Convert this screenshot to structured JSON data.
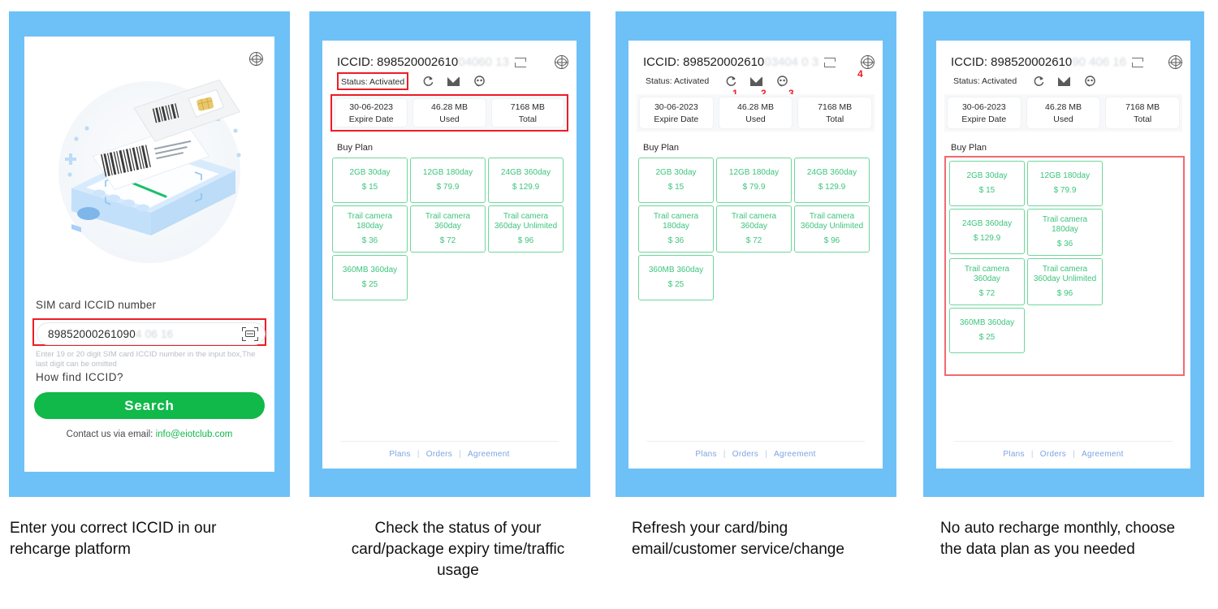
{
  "theme": {
    "blue_frame": "#6ec1f7",
    "red_highlight": "#ee1c25",
    "green_accent": "#10b949",
    "plan_green": "#3ec47d",
    "link_blue": "#7ea4e0"
  },
  "panel1": {
    "globe_icon": "globe-icon",
    "field_label": "SIM card ICCID number",
    "iccid_visible": "89852000261090",
    "iccid_masked": "4 06 16",
    "scan_icon": "barcode-scan-icon",
    "hint": "Enter 19 or 20 digit SIM card ICCID number in the input box,The last digit can be omitted",
    "how_find": "How find ICCID?",
    "search_label": "Search",
    "contact_prefix": "Contact us via email: ",
    "contact_email": "info@eiotclub.com"
  },
  "panel2": {
    "iccid_prefix": "ICCID: 898520002610",
    "iccid_masked": "04060 13",
    "swap_icon": "swap-icon",
    "globe_icon": "globe-icon",
    "status": "Status: Activated",
    "icons": [
      "refresh-icon",
      "mail-icon",
      "customer-service-icon"
    ],
    "stats": [
      {
        "value": "30-06-2023",
        "key": "Expire Date"
      },
      {
        "value": "46.28 MB",
        "key": "Used"
      },
      {
        "value": "7168 MB",
        "key": "Total"
      }
    ],
    "buy_plan_label": "Buy Plan",
    "plans": [
      {
        "name": "2GB 30day",
        "price": "$ 15"
      },
      {
        "name": "12GB 180day",
        "price": "$ 79.9"
      },
      {
        "name": "24GB 360day",
        "price": "$ 129.9"
      },
      {
        "name": "Trail camera 180day",
        "price": "$ 36"
      },
      {
        "name": "Trail camera 360day",
        "price": "$ 72"
      },
      {
        "name": "Trail camera 360day Unlimited",
        "price": "$ 96"
      },
      {
        "name": "360MB 360day",
        "price": "$ 25"
      }
    ],
    "footer": {
      "plans": "Plans",
      "orders": "Orders",
      "agreement": "Agreement",
      "sep": "|"
    }
  },
  "panel3": {
    "iccid_prefix": "ICCID: 898520002610",
    "iccid_masked": "03404 0 3",
    "status": "Status: Activated",
    "markers": [
      "1",
      "2",
      "3",
      "4"
    ],
    "stats": [
      {
        "value": "30-06-2023",
        "key": "Expire Date"
      },
      {
        "value": "46.28 MB",
        "key": "Used"
      },
      {
        "value": "7168 MB",
        "key": "Total"
      }
    ],
    "buy_plan_label": "Buy Plan",
    "plans": [
      {
        "name": "2GB 30day",
        "price": "$ 15"
      },
      {
        "name": "12GB 180day",
        "price": "$ 79.9"
      },
      {
        "name": "24GB 360day",
        "price": "$ 129.9"
      },
      {
        "name": "Trail camera 180day",
        "price": "$ 36"
      },
      {
        "name": "Trail camera 360day",
        "price": "$ 72"
      },
      {
        "name": "Trail camera 360day Unlimited",
        "price": "$ 96"
      },
      {
        "name": "360MB 360day",
        "price": "$ 25"
      }
    ],
    "footer": {
      "plans": "Plans",
      "orders": "Orders",
      "agreement": "Agreement",
      "sep": "|"
    }
  },
  "panel4": {
    "iccid_prefix": "ICCID: 898520002610",
    "iccid_masked": "90 406 16",
    "status": "Status: Activated",
    "stats": [
      {
        "value": "30-06-2023",
        "key": "Expire Date"
      },
      {
        "value": "46.28 MB",
        "key": "Used"
      },
      {
        "value": "7168 MB",
        "key": "Total"
      }
    ],
    "buy_plan_label": "Buy Plan",
    "plans": [
      {
        "name": "2GB 30day",
        "price": "$ 15"
      },
      {
        "name": "12GB 180day",
        "price": "$ 79.9"
      },
      {
        "name": "24GB 360day",
        "price": "$ 129.9"
      },
      {
        "name": "Trail camera 180day",
        "price": "$ 36"
      },
      {
        "name": "Trail camera 360day",
        "price": "$ 72"
      },
      {
        "name": "Trail camera 360day Unlimited",
        "price": "$ 96"
      },
      {
        "name": "360MB 360day",
        "price": "$ 25"
      }
    ],
    "footer": {
      "plans": "Plans",
      "orders": "Orders",
      "agreement": "Agreement",
      "sep": "|"
    }
  },
  "captions": {
    "c1": "Enter you correct ICCID in our rehcarge platform",
    "c2": "Check the status of your card/package expiry time/traffic usage",
    "c3": "Refresh your card/bing email/customer service/change",
    "c4": "No auto recharge monthly, choose the data plan as you needed"
  }
}
